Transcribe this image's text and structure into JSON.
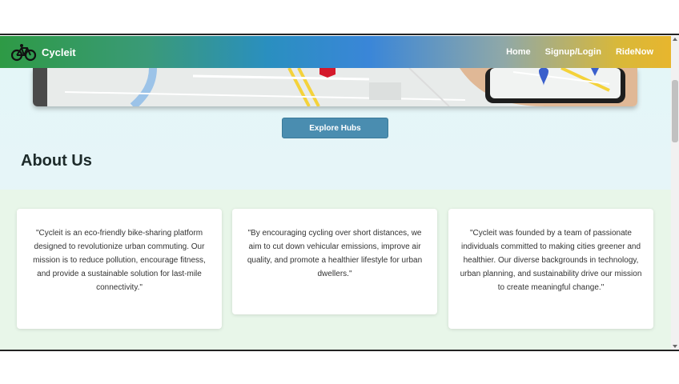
{
  "brand": {
    "name": "Cycleit",
    "icon": "bicycle-icon"
  },
  "nav": {
    "items": [
      {
        "label": "Home"
      },
      {
        "label": "Signup/Login"
      },
      {
        "label": "RideNow"
      }
    ]
  },
  "hero": {
    "explore_label": "Explore Hubs"
  },
  "about": {
    "title": "About Us",
    "cards": [
      {
        "text": "\"Cycleit is an eco-friendly bike-sharing platform designed to revolutionize urban commuting. Our mission is to reduce pollution, encourage fitness, and provide a sustainable solution for last-mile connectivity.\""
      },
      {
        "text": "\"By encouraging cycling over short distances, we aim to cut down vehicular emissions, improve air quality, and promote a healthier lifestyle for urban dwellers.\""
      },
      {
        "text": "\"Cycleit was founded by a team of passionate individuals committed to making cities greener and healthier. Our diverse backgrounds in technology, urban planning, and sustainability drive our mission to create meaningful change.\""
      }
    ]
  },
  "colors": {
    "nav_start": "#2e9a45",
    "nav_mid": "#3a86d8",
    "nav_end": "#e7b62e",
    "button": "#4a8db0",
    "about_bg": "#e8f6e9"
  }
}
